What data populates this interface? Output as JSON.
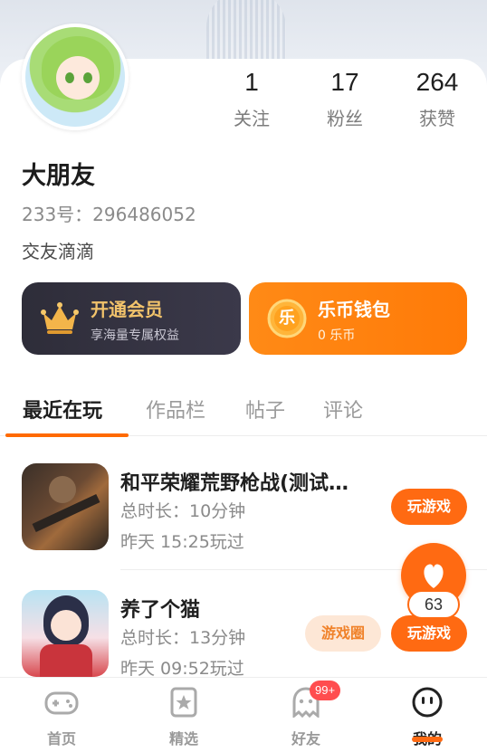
{
  "profile": {
    "stats": [
      {
        "value": "1",
        "label": "关注"
      },
      {
        "value": "17",
        "label": "粉丝"
      },
      {
        "value": "264",
        "label": "获赞"
      }
    ],
    "name": "大朋友",
    "uid": "233号：296486052",
    "signature": "交友滴滴"
  },
  "vip": {
    "title": "开通会员",
    "subtitle": "享海量专属权益"
  },
  "wallet": {
    "title": "乐币钱包",
    "subtitle": "0 乐币",
    "coin_glyph": "乐"
  },
  "tabs": [
    "最近在玩",
    "作品栏",
    "帖子",
    "评论"
  ],
  "games": [
    {
      "title": "和平荣耀荒野枪战(测试…",
      "duration": "总时长：10分钟",
      "last_played": "昨天 15:25玩过",
      "play_label": "玩游戏"
    },
    {
      "title": "养了个猫",
      "duration": "总时长：13分钟",
      "last_played": "昨天 09:52玩过",
      "play_label": "玩游戏",
      "circle_label": "游戏圈"
    }
  ],
  "fab": {
    "count": "63",
    "icon": "heart-icon"
  },
  "nav": [
    {
      "label": "首页",
      "icon": "gamepad-icon"
    },
    {
      "label": "精选",
      "icon": "star-card-icon"
    },
    {
      "label": "好友",
      "icon": "ghost-icon",
      "badge": "99+"
    },
    {
      "label": "我的",
      "icon": "smiley-icon"
    }
  ],
  "colors": {
    "accent": "#ff6a12",
    "vip_bg": "#2e2d39",
    "wallet_bg": "#ff8a16"
  }
}
